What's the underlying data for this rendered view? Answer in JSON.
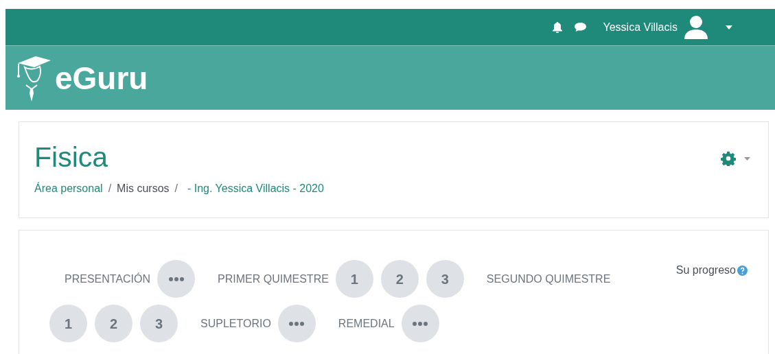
{
  "navbar": {
    "user_name": "Yessica Villacis"
  },
  "banner": {
    "logo_text": "eGuru"
  },
  "header": {
    "title": "Fisica",
    "breadcrumb_separator": "/",
    "breadcrumb": [
      {
        "label": "Área personal",
        "link": true
      },
      {
        "label": "Mis cursos",
        "link": false
      },
      {
        "label": "- Ing. Yessica Villacis - 2020",
        "link": true
      }
    ]
  },
  "course_nav": {
    "sections": [
      {
        "title": "PRESENTACIÓN",
        "items": [
          {
            "kind": "more"
          }
        ]
      },
      {
        "title": "PRIMER QUIMESTRE",
        "items": [
          {
            "kind": "number",
            "label": "1"
          },
          {
            "kind": "number",
            "label": "2"
          },
          {
            "kind": "number",
            "label": "3"
          }
        ]
      },
      {
        "title": "SEGUNDO QUIMESTRE",
        "items": [
          {
            "kind": "number",
            "label": "1"
          },
          {
            "kind": "number",
            "label": "2"
          },
          {
            "kind": "number",
            "label": "3"
          }
        ]
      },
      {
        "title": "SUPLETORIO",
        "items": [
          {
            "kind": "more"
          }
        ]
      },
      {
        "title": "REMEDIAL",
        "items": [
          {
            "kind": "more"
          }
        ]
      }
    ],
    "progress_label": "Su progreso"
  }
}
